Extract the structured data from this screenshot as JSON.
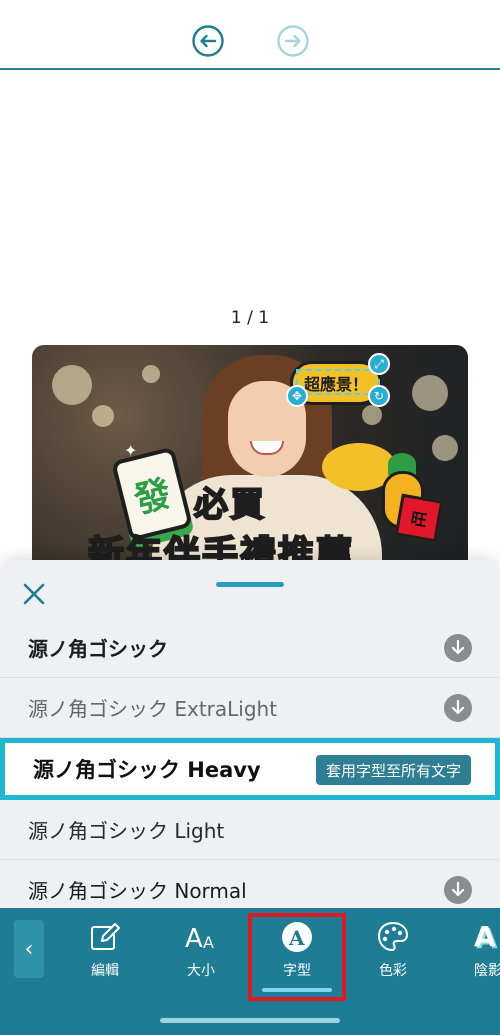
{
  "topbar": {
    "undo_icon": "undo-arrow-icon",
    "redo_icon": "redo-arrow-icon"
  },
  "canvas": {
    "page_indicator": "1 / 1",
    "image": {
      "badge_text": "超應景！",
      "tile_text": "發",
      "title_line1": "必買",
      "title_line2": "新年伴手禮推薦",
      "wang_text": "旺"
    }
  },
  "font_sheet": {
    "close_icon": "close-x-icon",
    "fonts": [
      {
        "name": "源ノ角ゴシック",
        "state": "download"
      },
      {
        "name": "源ノ角ゴシック ExtraLight",
        "state": "download"
      },
      {
        "name": "源ノ角ゴシック Heavy",
        "state": "selected"
      },
      {
        "name": "源ノ角ゴシック Light",
        "state": "installed"
      },
      {
        "name": "源ノ角ゴシック Normal",
        "state": "download"
      }
    ],
    "apply_all_label": "套用字型至所有文字"
  },
  "toolbar": {
    "items": [
      {
        "label": "編輯",
        "icon": "edit-pencil-icon"
      },
      {
        "label": "大小",
        "icon": "font-size-icon"
      },
      {
        "label": "字型",
        "icon": "font-a-icon",
        "active": true
      },
      {
        "label": "色彩",
        "icon": "palette-icon"
      },
      {
        "label": "陰影",
        "icon": "shadow-text-icon"
      }
    ],
    "back_icon": "chevron-left-icon"
  },
  "colors": {
    "accent": "#1e7d94",
    "selection_border": "#1fb6d4",
    "highlight_red": "#e01a22"
  }
}
